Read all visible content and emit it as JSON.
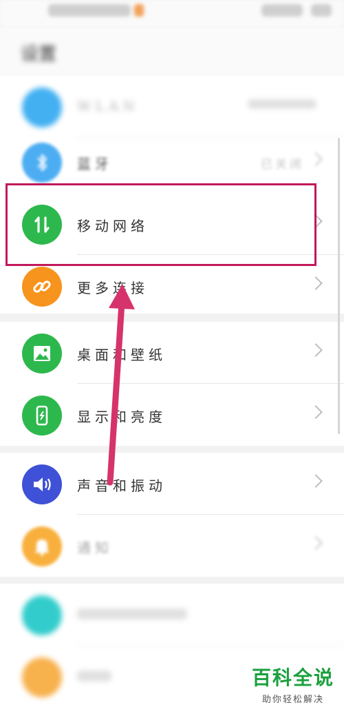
{
  "header": {
    "title": "设置"
  },
  "settings": {
    "group1": [
      {
        "label": "WLAN",
        "value": "",
        "color": "#2ea8f0"
      },
      {
        "label": "蓝牙",
        "value": "已关闭",
        "color": "#2d9ff0"
      },
      {
        "label": "移动网络",
        "value": "",
        "color": "#2db84d"
      },
      {
        "label": "更多连接",
        "value": "",
        "color": "#f7941d"
      }
    ],
    "group2": [
      {
        "label": "桌面和壁纸",
        "value": "",
        "color": "#2db84d"
      },
      {
        "label": "显示和亮度",
        "value": "",
        "color": "#2db84d"
      }
    ],
    "group3": [
      {
        "label": "声音和振动",
        "value": "",
        "color": "#3f51d6"
      },
      {
        "label": "通知",
        "value": "",
        "color": "#f7a21b"
      }
    ],
    "group4": [
      {
        "label": "",
        "value": "",
        "color": "#1cc7c7"
      },
      {
        "label": "",
        "value": "",
        "color": "#f7941d"
      }
    ]
  },
  "annotation": {
    "highlight_color": "#c2185b",
    "arrow_color": "#d6336c"
  },
  "watermark": {
    "line1": "百科全说",
    "line2": "助你轻松解决",
    "color": "#1aa03c"
  }
}
